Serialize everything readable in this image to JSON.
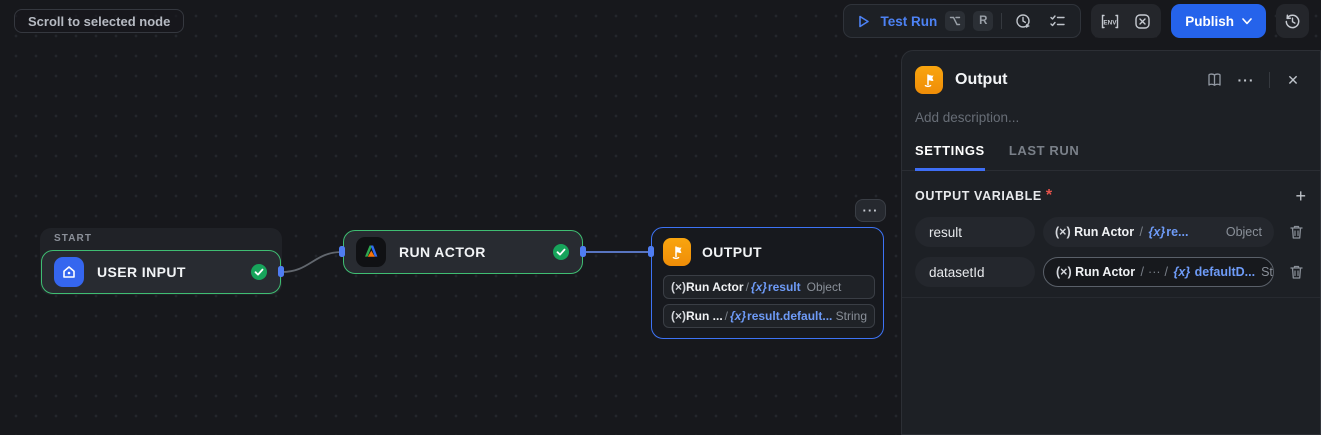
{
  "glyphs": {
    "ellipsis": "···",
    "close": "✕",
    "plus": "+",
    "slash": "/",
    "fx": "(×)",
    "varx": "{x}",
    "key_r": "R"
  },
  "canvas": {
    "scroll_button_label": "Scroll to selected node",
    "start_group_label": "START",
    "nodes": {
      "user_input": {
        "title": "USER INPUT"
      },
      "run_actor": {
        "title": "RUN ACTOR"
      },
      "output": {
        "title": "OUTPUT",
        "mappings": [
          {
            "source": "Run Actor",
            "path": "result",
            "type": "Object"
          },
          {
            "source": "Run ...",
            "path": "result.default...",
            "type": "String"
          }
        ]
      }
    }
  },
  "toolbar": {
    "test_run_label": "Test Run",
    "publish_label": "Publish"
  },
  "panel": {
    "title": "Output",
    "description_placeholder": "Add description...",
    "tabs": {
      "settings": "SETTINGS",
      "last_run": "LAST RUN"
    },
    "section_title": "OUTPUT VARIABLE",
    "required_marker": "*",
    "variables": [
      {
        "name": "result",
        "source": "Run Actor",
        "path": "re...",
        "type": "Object"
      },
      {
        "name": "datasetId",
        "source": "Run Actor",
        "mid": "···",
        "path": "defaultD...",
        "type": "Str..."
      }
    ]
  },
  "colors": {
    "accent_blue": "#2563eb",
    "link_blue": "#6e9bf7",
    "node_green": "#3fbd72",
    "check_green": "#17a45b",
    "icon_orange": "#f6960b",
    "danger_red": "#e5534b"
  }
}
